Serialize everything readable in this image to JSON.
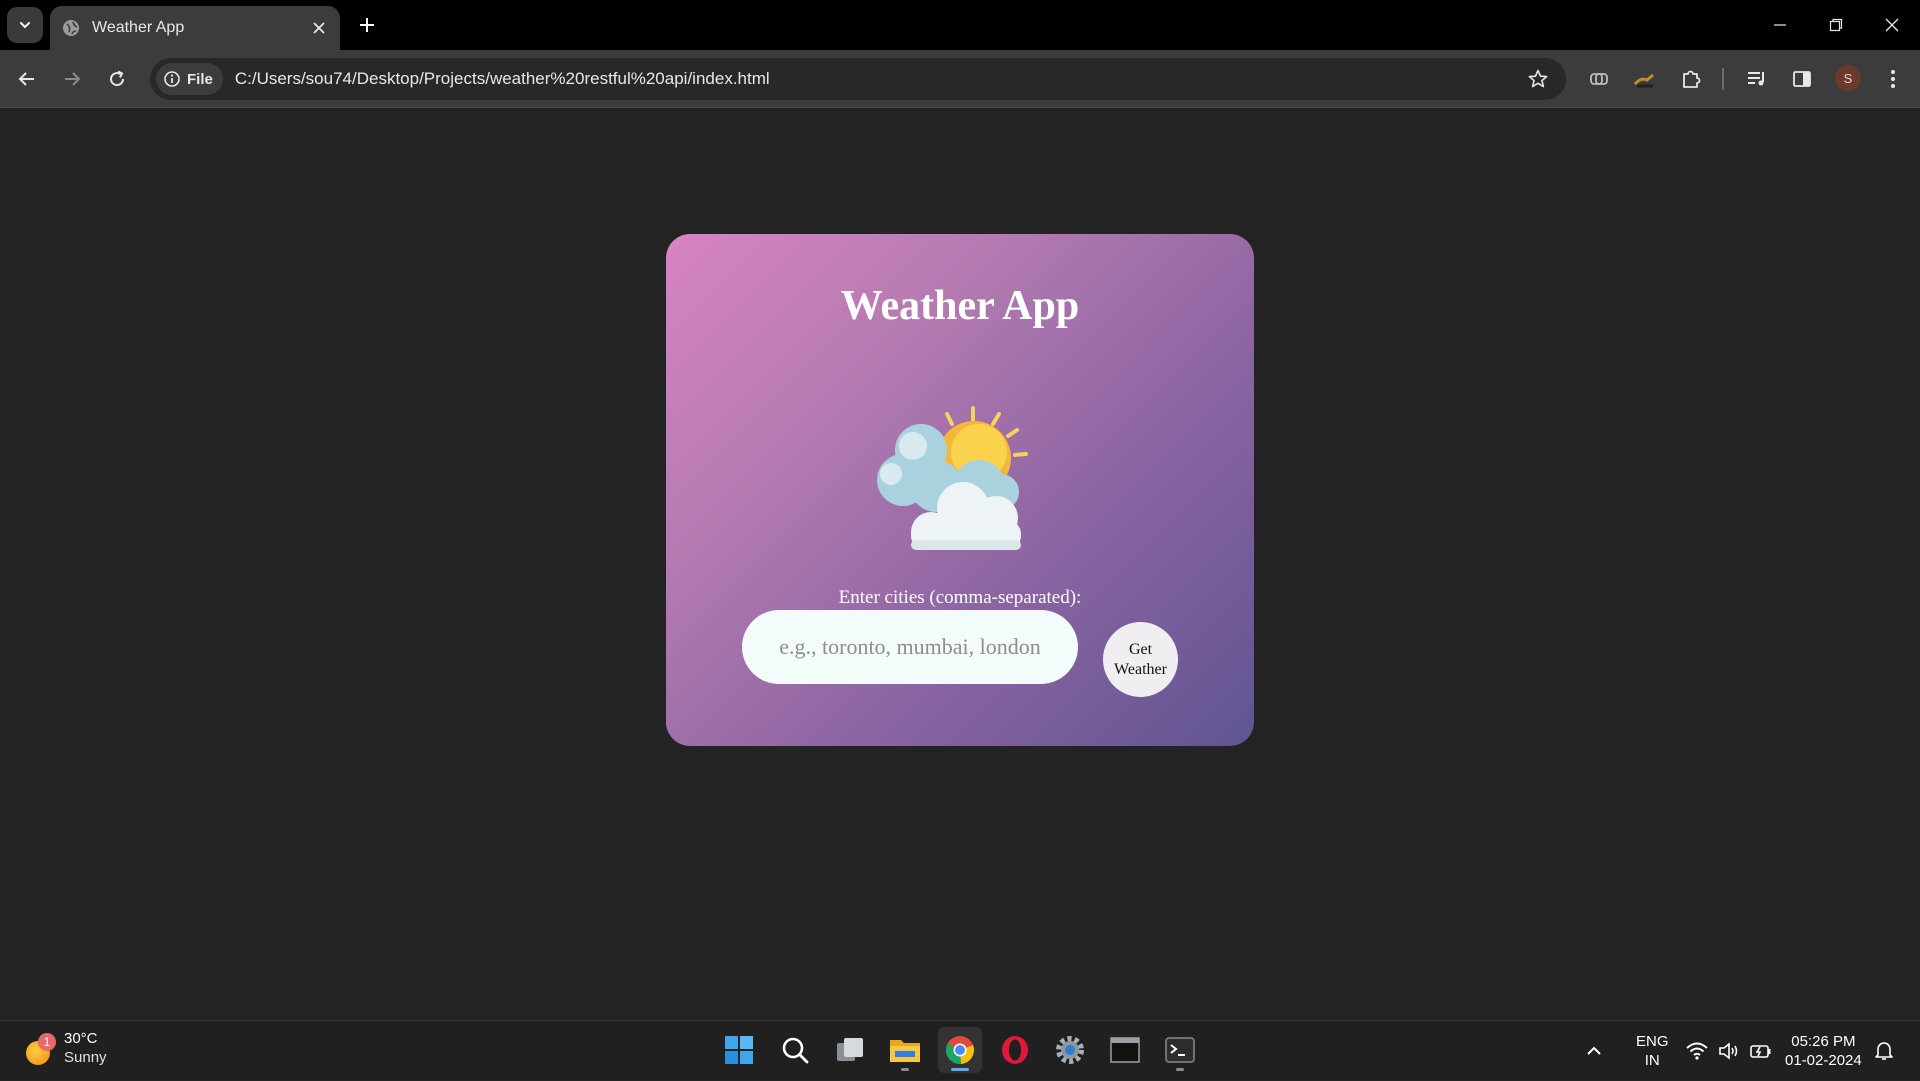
{
  "browser": {
    "tab_title": "Weather App",
    "site_chip_label": "File",
    "url": "C:/Users/sou74/Desktop/Projects/weather%20restful%20api/index.html",
    "profile_initial": "S"
  },
  "page": {
    "title": "Weather App",
    "input_label": "Enter cities (comma-separated):",
    "input_placeholder": "e.g., toronto, mumbai, london",
    "input_value": "",
    "button_label": "Get Weather",
    "colors": {
      "page_background": "#232323",
      "card_gradient_start": "#d884c0",
      "card_gradient_end": "#5f5591",
      "input_background": "#f3fbfb"
    }
  },
  "taskbar": {
    "weather_temp": "30°C",
    "weather_condition": "Sunny",
    "weather_badge": "1",
    "language_line1": "ENG",
    "language_line2": "IN",
    "time": "05:26 PM",
    "date": "01-02-2024"
  }
}
